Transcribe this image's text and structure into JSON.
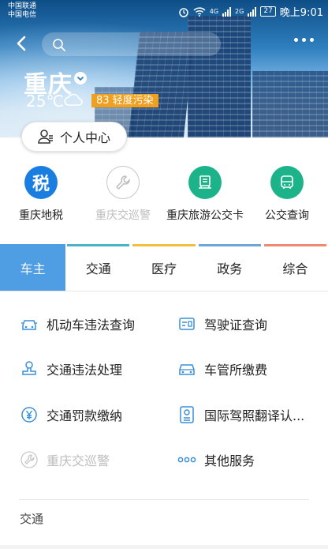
{
  "status_bar": {
    "carrier_1": "中国联通",
    "carrier_2": "中国电信",
    "net_1": "4G",
    "net_2": "2G",
    "battery": "27",
    "time": "晚上9:01"
  },
  "header": {
    "search_placeholder": "",
    "city": "重庆",
    "temperature": "25℃",
    "aqi": "83 轻度污染",
    "profile_label": "个人中心"
  },
  "quick_services": [
    {
      "label": "重庆地税",
      "icon": "tax-icon",
      "glyph": "税",
      "color": "#1a7ee0",
      "enabled": true
    },
    {
      "label": "重庆交巡警",
      "icon": "wrench-icon",
      "glyph": "",
      "color": "#ffffff",
      "enabled": false
    },
    {
      "label": "重庆旅游公交卡",
      "icon": "bus-card-icon",
      "glyph": "",
      "color": "#1db38a",
      "enabled": true
    },
    {
      "label": "公交查询",
      "icon": "bus-icon",
      "glyph": "",
      "color": "#1db38a",
      "enabled": true
    }
  ],
  "tabs": [
    {
      "label": "车主",
      "color": "#4f9de2",
      "active": true
    },
    {
      "label": "交通",
      "color": "#4bb3c9",
      "active": false
    },
    {
      "label": "医疗",
      "color": "#f0c040",
      "active": false
    },
    {
      "label": "政务",
      "color": "#6fa5d8",
      "active": false
    },
    {
      "label": "综合",
      "color": "#ef8a72",
      "active": false
    }
  ],
  "services": [
    {
      "label": "机动车违法查询",
      "icon": "car-icon",
      "enabled": true
    },
    {
      "label": "驾驶证查询",
      "icon": "license-card-icon",
      "enabled": true
    },
    {
      "label": "交通违法处理",
      "icon": "stamp-icon",
      "enabled": true
    },
    {
      "label": "车管所缴费",
      "icon": "car-front-icon",
      "enabled": true
    },
    {
      "label": "交通罚款缴纳",
      "icon": "yuan-icon",
      "enabled": true
    },
    {
      "label": "国际驾照翻译认...",
      "icon": "document-icon",
      "enabled": true
    },
    {
      "label": "重庆交巡警",
      "icon": "wrench-icon",
      "enabled": false
    },
    {
      "label": "其他服务",
      "icon": "more-dots-icon",
      "enabled": true
    }
  ],
  "section_title": "交通",
  "colors": {
    "accent": "#4f9de2",
    "icon_blue": "#3a8fd8",
    "aqi_badge": "#f0a020"
  }
}
